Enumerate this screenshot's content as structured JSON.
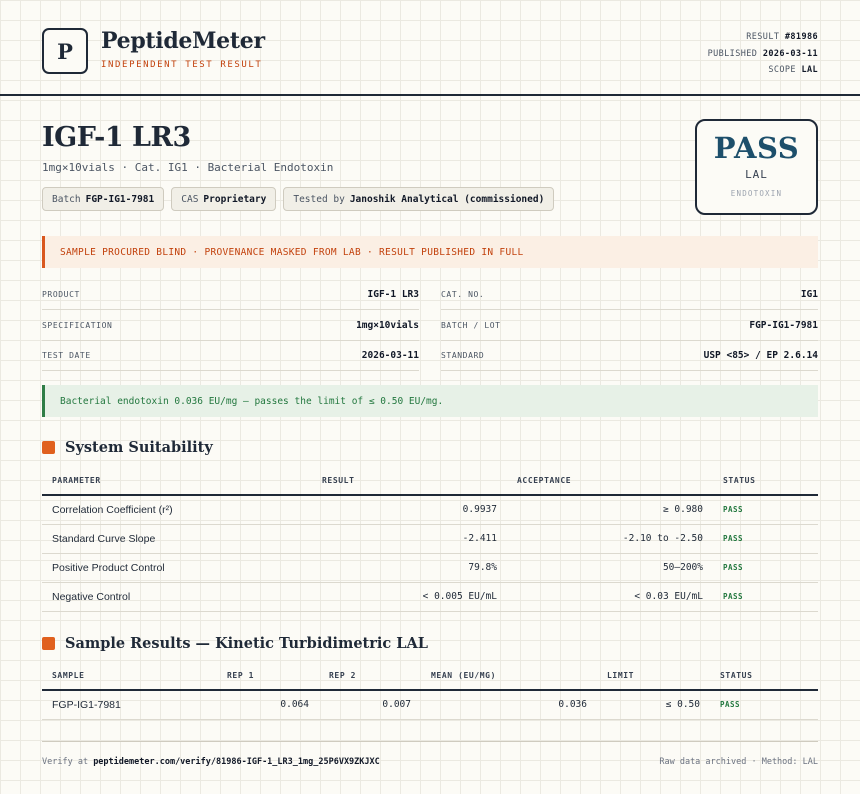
{
  "brand": {
    "logo_letter": "P",
    "name": "PeptideMeter",
    "tagline": "INDEPENDENT TEST RESULT"
  },
  "meta": {
    "result_label": "RESULT",
    "result_value": "#81986",
    "published_label": "PUBLISHED",
    "published_value": "2026-03-11",
    "scope_label": "SCOPE",
    "scope_value": "LAL"
  },
  "product": {
    "title": "IGF-1 LR3",
    "subtitle": "1mg×10vials · Cat. IG1 · Bacterial Endotoxin",
    "chips": [
      {
        "label": "Batch",
        "value": "FGP-IG1-7981"
      },
      {
        "label": "CAS",
        "value": "Proprietary"
      },
      {
        "label": "Tested by",
        "value": "Janoshik Analytical (commissioned)"
      }
    ]
  },
  "stamp": {
    "verdict": "PASS",
    "method": "LAL",
    "category": "ENDOTOXIN"
  },
  "notice": "SAMPLE PROCURED BLIND · PROVENANCE MASKED FROM LAB · RESULT PUBLISHED IN FULL",
  "info": {
    "left": [
      {
        "label": "PRODUCT",
        "value": "IGF-1 LR3"
      },
      {
        "label": "SPECIFICATION",
        "value": "1mg×10vials"
      },
      {
        "label": "TEST DATE",
        "value": "2026-03-11"
      }
    ],
    "right": [
      {
        "label": "CAT. NO.",
        "value": "IG1"
      },
      {
        "label": "BATCH / LOT",
        "value": "FGP-IG1-7981"
      },
      {
        "label": "STANDARD",
        "value": "USP <85> / EP 2.6.14"
      }
    ]
  },
  "summary": "Bacterial endotoxin 0.036 EU/mg — passes the limit of ≤ 0.50 EU/mg.",
  "suitability": {
    "title": "System Suitability",
    "headers": [
      "PARAMETER",
      "RESULT",
      "ACCEPTANCE",
      "STATUS"
    ],
    "rows": [
      {
        "parameter": "Correlation Coefficient (r²)",
        "result": "0.9937",
        "acceptance": "≥ 0.980",
        "status": "PASS"
      },
      {
        "parameter": "Standard Curve Slope",
        "result": "-2.411",
        "acceptance": "-2.10 to -2.50",
        "status": "PASS"
      },
      {
        "parameter": "Positive Product Control",
        "result": "79.8%",
        "acceptance": "50–200%",
        "status": "PASS"
      },
      {
        "parameter": "Negative Control",
        "result": "< 0.005 EU/mL",
        "acceptance": "< 0.03 EU/mL",
        "status": "PASS"
      }
    ]
  },
  "samples": {
    "title": "Sample Results — Kinetic Turbidimetric LAL",
    "headers": [
      "SAMPLE",
      "REP 1",
      "REP 2",
      "MEAN (EU/MG)",
      "LIMIT",
      "STATUS"
    ],
    "rows": [
      {
        "sample": "FGP-IG1-7981",
        "rep1": "0.064",
        "rep2": "0.007",
        "mean": "0.036",
        "limit": "≤ 0.50",
        "status": "PASS"
      }
    ]
  },
  "footer": {
    "verify_prefix": "Verify at",
    "verify_url": "peptidemeter.com/verify/81986-IGF-1_LR3_1mg_25P6VX9ZKJXC",
    "archive_note": "Raw data archived · Method: LAL"
  },
  "colors": {
    "accent_orange": "#e0601e",
    "pass_green": "#23783f",
    "stamp_blue": "#1d4f6b",
    "ink": "#1f2937"
  }
}
